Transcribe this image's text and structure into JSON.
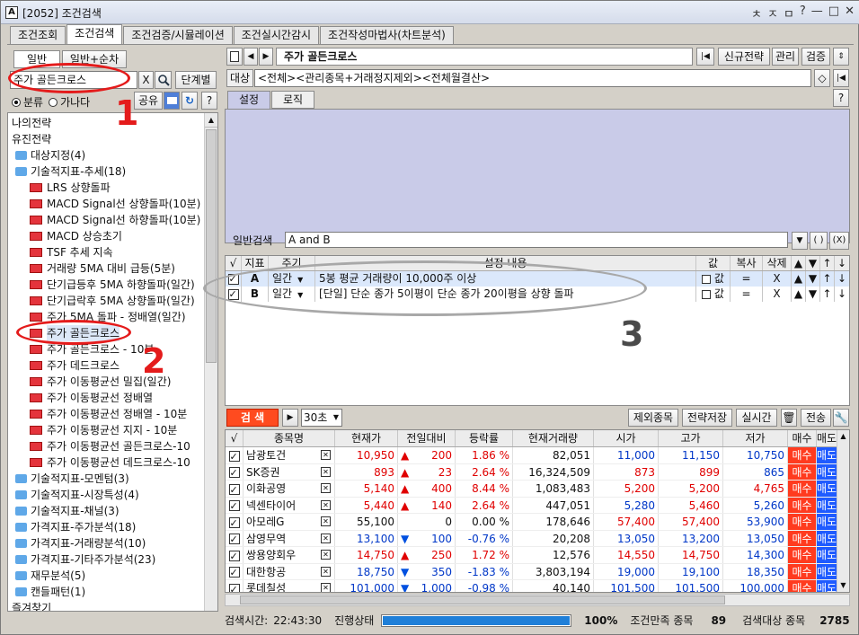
{
  "window": {
    "title": "[2052] 조건검색",
    "app_icon": "A",
    "title_icons": [
      "ㅊ",
      "ㅈ",
      "ㅁ",
      "?",
      "—",
      "□",
      "✕"
    ]
  },
  "main_tabs": [
    "조건조회",
    "조건검색",
    "조건검증/시뮬레이션",
    "조건실시간감시",
    "조건작성마법사(차트분석)"
  ],
  "left": {
    "sub_tabs": [
      "일반",
      "일반+순차"
    ],
    "search_value": "주가 골든크로스",
    "clear_label": "X",
    "stage_label": "단계별",
    "radio_cat": "분류",
    "radio_alpha": "가나다",
    "share_label": "공유",
    "help": "?",
    "tree": [
      {
        "t": "나의전략",
        "k": "root"
      },
      {
        "t": "유진전략",
        "k": "root"
      },
      {
        "t": "대상지정(4)",
        "k": "folder"
      },
      {
        "t": "기술적지표-추세(18)",
        "k": "folder"
      },
      {
        "t": "LRS 상향돌파",
        "k": "item"
      },
      {
        "t": "MACD Signal선 상향돌파(10분)",
        "k": "item"
      },
      {
        "t": "MACD Signal선 하향돌파(10분)",
        "k": "item"
      },
      {
        "t": "MACD 상승초기",
        "k": "item"
      },
      {
        "t": "TSF 추세 지속",
        "k": "item"
      },
      {
        "t": "거래량 5MA 대비 급등(5분)",
        "k": "item"
      },
      {
        "t": "단기급등후 5MA 하향돌파(일간)",
        "k": "item"
      },
      {
        "t": "단기급락후 5MA 상향돌파(일간)",
        "k": "item"
      },
      {
        "t": "주가 5MA 돌파 - 정배열(일간)",
        "k": "item"
      },
      {
        "t": "주가 골든크로스",
        "k": "item",
        "sel": true
      },
      {
        "t": "주가 골든크로스 - 10분",
        "k": "item"
      },
      {
        "t": "주가 데드크로스",
        "k": "item"
      },
      {
        "t": "주가 이동평균선 밀집(일간)",
        "k": "item"
      },
      {
        "t": "주가 이동평균선 정배열",
        "k": "item"
      },
      {
        "t": "주가 이동평균선 정배열 - 10분",
        "k": "item"
      },
      {
        "t": "주가 이동평균선 지지 - 10분",
        "k": "item"
      },
      {
        "t": "주가 이동평균선 골든크로스-10",
        "k": "item"
      },
      {
        "t": "주가 이동평균선 데드크로스-10",
        "k": "item"
      },
      {
        "t": "기술적지표-모멘텀(3)",
        "k": "folder"
      },
      {
        "t": "기술적지표-시장특성(4)",
        "k": "folder"
      },
      {
        "t": "기술적지표-채널(3)",
        "k": "folder"
      },
      {
        "t": "가격지표-주가분석(18)",
        "k": "folder"
      },
      {
        "t": "가격지표-거래량분석(10)",
        "k": "folder"
      },
      {
        "t": "가격지표-기타주가분석(23)",
        "k": "folder"
      },
      {
        "t": "재무분석(5)",
        "k": "folder"
      },
      {
        "t": "캔들패턴(1)",
        "k": "folder"
      },
      {
        "t": "즐겨찾기",
        "k": "root"
      }
    ]
  },
  "right": {
    "strategy_name": "주가 골든크로스",
    "new_strategy": "신규전략",
    "manage": "관리",
    "verify": "검증",
    "target_label": "대상",
    "target_value": "<전체><관리종목+거래정지제외><전체월결산>",
    "tabs": [
      "설정",
      "로직"
    ],
    "help": "?",
    "general_label": "일반검색",
    "general_value": "A and B",
    "paren_open": "( )",
    "paren_x": "(X)",
    "cond_headers": [
      "√",
      "지표",
      "주기",
      "설정 내용",
      "값",
      "복사",
      "삭제",
      "▲",
      "▼",
      "↑",
      "↓"
    ],
    "conditions": [
      {
        "id": "A",
        "period": "일간",
        "desc": "5봉 평균 거래량이 10,000주 이상",
        "val": "값",
        "copy": "=",
        "del": "X"
      },
      {
        "id": "B",
        "period": "일간",
        "desc": "[단일] 단순 종가 5이평이 단순 종가 20이평을 상향 돌파",
        "val": "값",
        "copy": "=",
        "del": "X"
      }
    ],
    "search_btn": "검 색",
    "interval": "30초",
    "exclude": "제외종목",
    "save_strategy": "전략저장",
    "realtime": "실시간",
    "send": "전송",
    "result_headers": [
      "√",
      "종목명",
      "현재가",
      "전일대비",
      "등락률",
      "현재거래량",
      "시가",
      "고가",
      "저가",
      "매수",
      "매도"
    ],
    "results": [
      {
        "name": "남광토건",
        "price": "10,950",
        "pc": "red",
        "dir": "▲",
        "chg": "200",
        "rate": "1.86 %",
        "vol": "82,051",
        "open": "11,000",
        "oc": "blue",
        "high": "11,150",
        "hc": "blue",
        "low": "10,750",
        "lc": "blue"
      },
      {
        "name": "SK증권",
        "price": "893",
        "pc": "red",
        "dir": "▲",
        "chg": "23",
        "rate": "2.64 %",
        "vol": "16,324,509",
        "open": "873",
        "oc": "red",
        "high": "899",
        "hc": "red",
        "low": "865",
        "lc": "blue"
      },
      {
        "name": "이화공영",
        "price": "5,140",
        "pc": "red",
        "dir": "▲",
        "chg": "400",
        "rate": "8.44 %",
        "vol": "1,083,483",
        "open": "5,200",
        "oc": "red",
        "high": "5,200",
        "hc": "red",
        "low": "4,765",
        "lc": "red"
      },
      {
        "name": "넥센타이어",
        "price": "5,440",
        "pc": "red",
        "dir": "▲",
        "chg": "140",
        "rate": "2.64 %",
        "vol": "447,051",
        "open": "5,280",
        "oc": "blue",
        "high": "5,460",
        "hc": "red",
        "low": "5,260",
        "lc": "blue"
      },
      {
        "name": "아모레G",
        "price": "55,100",
        "pc": "",
        "dir": "",
        "chg": "0",
        "rate": "0.00 %",
        "vol": "178,646",
        "open": "57,400",
        "oc": "red",
        "high": "57,400",
        "hc": "red",
        "low": "53,900",
        "lc": "blue"
      },
      {
        "name": "삼영무역",
        "price": "13,100",
        "pc": "blue",
        "dir": "▼",
        "chg": "100",
        "rate": "-0.76 %",
        "vol": "20,208",
        "open": "13,050",
        "oc": "blue",
        "high": "13,200",
        "hc": "blue",
        "low": "13,050",
        "lc": "blue"
      },
      {
        "name": "쌍용양회우",
        "price": "14,750",
        "pc": "red",
        "dir": "▲",
        "chg": "250",
        "rate": "1.72 %",
        "vol": "12,576",
        "open": "14,550",
        "oc": "red",
        "high": "14,750",
        "hc": "red",
        "low": "14,300",
        "lc": "blue"
      },
      {
        "name": "대한항공",
        "price": "18,750",
        "pc": "blue",
        "dir": "▼",
        "chg": "350",
        "rate": "-1.83 %",
        "vol": "3,803,194",
        "open": "19,000",
        "oc": "blue",
        "high": "19,100",
        "hc": "blue",
        "low": "18,350",
        "lc": "blue"
      },
      {
        "name": "롯데칠성",
        "price": "101,000",
        "pc": "blue",
        "dir": "▼",
        "chg": "1,000",
        "rate": "-0.98 %",
        "vol": "40,140",
        "open": "101,500",
        "oc": "blue",
        "high": "101,500",
        "hc": "blue",
        "low": "100,000",
        "lc": "blue"
      }
    ],
    "buy": "매수",
    "sell": "매도"
  },
  "status": {
    "time_label": "검색시간:",
    "time": "22:43:30",
    "progress_label": "진행상태",
    "progress_pct": "100%",
    "progress_fraction": 1.0,
    "match_label": "조건만족 종목",
    "match": "89",
    "target_label": "검색대상 종목",
    "target": "2785"
  },
  "annotations": [
    "1",
    "2",
    "3"
  ],
  "colors": {
    "annotation": "#e41b1b",
    "search_btn": "#ff4b1f",
    "up": "#e00000",
    "down": "#0037c8"
  }
}
